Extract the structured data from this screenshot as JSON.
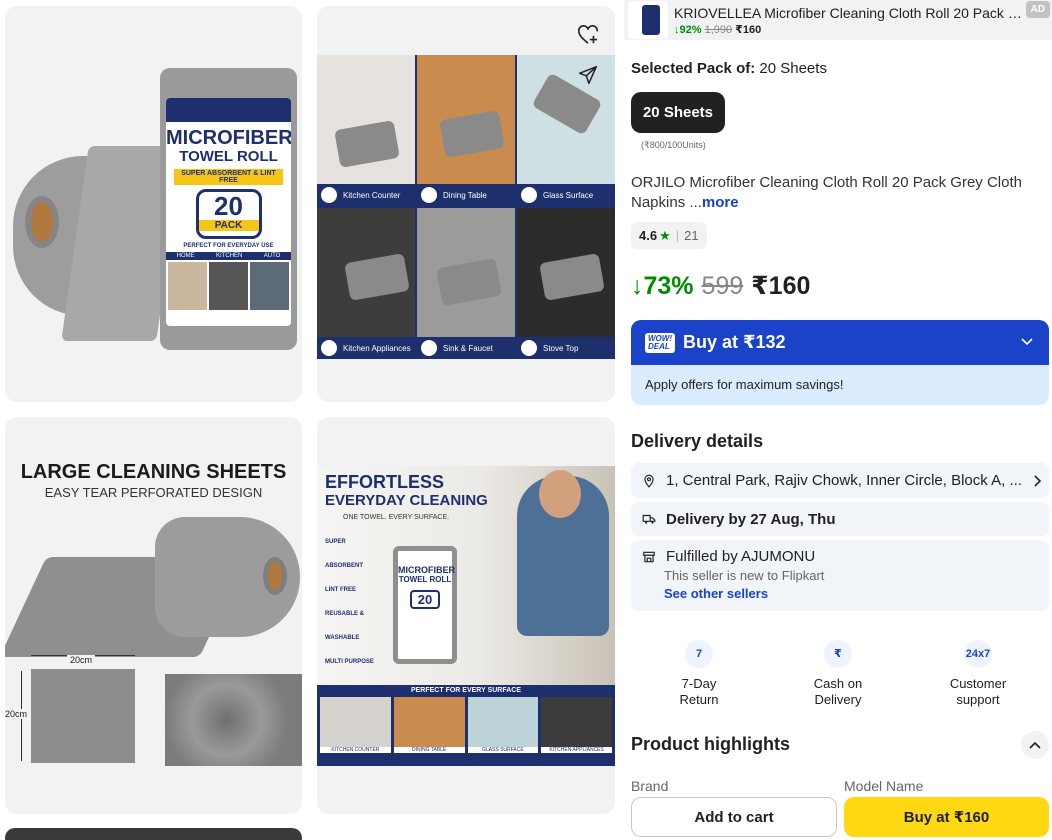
{
  "sticky_header": {
    "title": "KRIOVELLEA Microfiber Cleaning Cloth Roll 20 Pack Grey...",
    "discount": "↓92%",
    "mrp": "1,990",
    "price": "₹160",
    "ad_badge": "AD"
  },
  "gallery": {
    "image1": {
      "label_title": "MICROFIBER",
      "label_subtitle": "TOWEL ROLL",
      "label_strip": "SUPER ABSORBENT & LINT FREE",
      "pack_count": "20",
      "pack_word": "PACK",
      "label_footer": "PERFECT FOR EVERYDAY USE",
      "uses": [
        "HOME",
        "KITCHEN",
        "AUTO"
      ]
    },
    "image2": {
      "captions": [
        "Kitchen Counter",
        "Dining Table",
        "Glass Surface",
        "Kitchen Appliances",
        "Sink & Faucet",
        "Stove Top"
      ]
    },
    "image3": {
      "title": "LARGE CLEANING SHEETS",
      "subtitle": "EASY TEAR PERFORATED DESIGN",
      "width_label": "20cm",
      "height_label": "20cm"
    },
    "image4": {
      "title_line1": "EFFORTLESS",
      "title_line2": "EVERYDAY CLEANING",
      "tagline": "ONE TOWEL. EVERY SURFACE.",
      "features": [
        "SUPER ABSORBENT",
        "LINT FREE",
        "REUSABLE & WASHABLE",
        "MULTI PURPOSE"
      ],
      "can_title": "MICROFIBER",
      "can_subtitle": "TOWEL ROLL",
      "can_count": "20",
      "strip_title": "PERFECT FOR EVERY SURFACE",
      "strip_captions": [
        "KITCHEN COUNTER",
        "DINING TABLE",
        "GLASS SURFACE",
        "KITCHEN APPLIANCES"
      ]
    }
  },
  "product": {
    "selected_label": "Selected Pack of:",
    "selected_value": "20 Sheets",
    "pack_chip": "20 Sheets",
    "unit_price": "(₹800/100Units)",
    "title": "ORJILO Microfiber Cleaning Cloth Roll 20 Pack Grey Cloth Napkins ...",
    "more": "more",
    "rating": "4.6",
    "star": "★",
    "rating_count": "21",
    "discount": "↓73%",
    "mrp": "599",
    "price": "₹160"
  },
  "offer": {
    "badge_line1": "WOW!",
    "badge_line2": "DEAL",
    "title": "Buy at ₹132",
    "subtitle": "Apply offers for maximum savings!"
  },
  "delivery": {
    "heading": "Delivery details",
    "address": "1, Central Park, Rajiv Chowk, Inner Circle, Block A, ...",
    "date": "Delivery by 27 Aug, Thu",
    "fulfilled": "Fulfilled by AJUMONU",
    "seller_note": "This seller is new to Flipkart",
    "other_sellers": "See other sellers"
  },
  "features": [
    {
      "icon": "7",
      "line1": "7-Day",
      "line2": "Return"
    },
    {
      "icon": "₹",
      "line1": "Cash on",
      "line2": "Delivery"
    },
    {
      "icon": "24x7",
      "line1": "Customer",
      "line2": "support"
    }
  ],
  "highlights": {
    "heading": "Product highlights",
    "col1": "Brand",
    "col2": "Model Name"
  },
  "actions": {
    "add_to_cart": "Add to cart",
    "buy": "Buy at ₹160"
  },
  "colors": {
    "brand_blue": "#1a43c9",
    "navy": "#1e2f6e",
    "yellow": "#ffd814",
    "green": "#008c00"
  }
}
